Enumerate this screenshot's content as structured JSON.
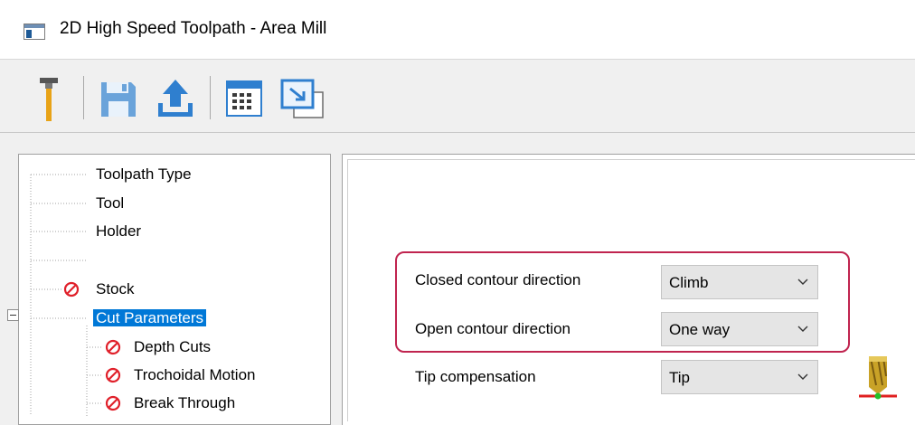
{
  "window": {
    "title": "2D High Speed Toolpath - Area Mill",
    "icon": "window-app-icon"
  },
  "toolbar": {
    "buttons": [
      {
        "name": "tool-button",
        "icon": "tool-holder-icon",
        "color": "#e8a317"
      },
      {
        "name": "save-button",
        "icon": "save-icon",
        "color": "#2f7fcf"
      },
      {
        "name": "export-button",
        "icon": "upload-icon",
        "color": "#2f7fcf"
      },
      {
        "name": "calculator-button",
        "icon": "calendar-grid-icon",
        "color": "#2f7fcf"
      },
      {
        "name": "minimize-button",
        "icon": "window-arrow-icon",
        "color": "#2f7fcf"
      }
    ]
  },
  "tree": {
    "items": [
      {
        "label": "Toolpath Type",
        "error": false,
        "selected": false
      },
      {
        "label": "Tool",
        "error": false,
        "selected": false
      },
      {
        "label": "Holder",
        "error": false,
        "selected": false
      },
      {
        "label": "",
        "error": false,
        "selected": false
      },
      {
        "label": "Stock",
        "error": true,
        "selected": false
      },
      {
        "label": "Cut Parameters",
        "error": false,
        "selected": true
      },
      {
        "label": "Depth Cuts",
        "error": true,
        "selected": false
      },
      {
        "label": "Trochoidal Motion",
        "error": true,
        "selected": false
      },
      {
        "label": "Break Through",
        "error": true,
        "selected": false
      }
    ]
  },
  "cut_parameters": {
    "closed_contour": {
      "label": "Closed contour direction",
      "value": "Climb"
    },
    "open_contour": {
      "label": "Open contour direction",
      "value": "One way"
    },
    "tip_compensation": {
      "label": "Tip compensation",
      "value": "Tip"
    }
  },
  "colors": {
    "highlight": "#c0244f",
    "selection": "#0078d7",
    "error": "#e0202a"
  }
}
